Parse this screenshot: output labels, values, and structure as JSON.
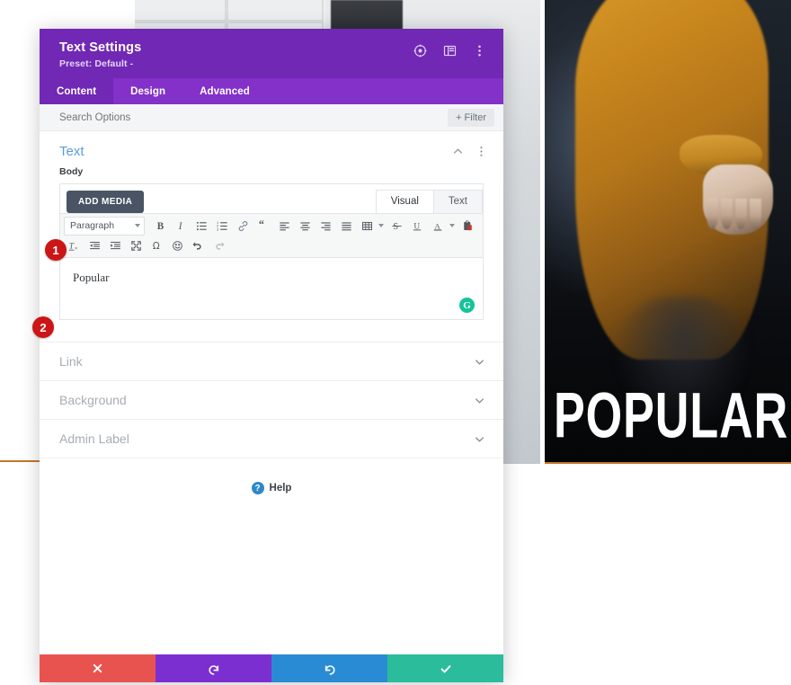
{
  "background": {
    "banner_word": "POPULAR"
  },
  "modal": {
    "title": "Text Settings",
    "preset": "Preset: Default -",
    "header_icons": [
      {
        "name": "target-icon"
      },
      {
        "name": "layout-panel-icon"
      },
      {
        "name": "kebab-menu-icon"
      }
    ],
    "tabs": [
      {
        "label": "Content",
        "active": true
      },
      {
        "label": "Design",
        "active": false
      },
      {
        "label": "Advanced",
        "active": false
      }
    ],
    "search": {
      "value": "",
      "placeholder": "Search Options"
    },
    "filter_button": "+ Filter",
    "section": {
      "title": "Text",
      "field_label": "Body",
      "add_media_button": "ADD MEDIA",
      "editor_tabs": [
        {
          "label": "Visual",
          "active": true
        },
        {
          "label": "Text",
          "active": false
        }
      ],
      "format_select": "Paragraph",
      "toolbar_row_1": [
        "bold-icon",
        "italic-icon",
        "bulleted-list-icon",
        "numbered-list-icon",
        "link-icon",
        "blockquote-icon",
        "align-left-icon",
        "align-center-icon",
        "align-right-icon",
        "align-justify-icon",
        "table-icon",
        "strikethrough-icon",
        "underline-icon",
        "text-color-icon",
        "paste-icon"
      ],
      "toolbar_row_2": [
        "clear-formatting-icon",
        "outdent-icon",
        "indent-icon",
        "fullscreen-icon",
        "special-character-icon",
        "emoji-icon",
        "undo-icon",
        "redo-icon"
      ],
      "editor_content": "Popular",
      "grammarly_badge": "G"
    },
    "accordion": [
      {
        "label": "Link"
      },
      {
        "label": "Background"
      },
      {
        "label": "Admin Label"
      }
    ],
    "help": {
      "icon_glyph": "?",
      "label": "Help"
    },
    "footer": [
      {
        "name": "cancel-button",
        "icon": "close-icon"
      },
      {
        "name": "undo-button",
        "icon": "undo-arrow-icon"
      },
      {
        "name": "redo-button",
        "icon": "redo-arrow-icon"
      },
      {
        "name": "save-button",
        "icon": "checkmark-icon"
      }
    ]
  },
  "callouts": [
    {
      "number": "1"
    },
    {
      "number": "2"
    }
  ],
  "colors": {
    "header_purple": "#7128b5",
    "tabbar_purple": "#8331c9",
    "section_title_blue": "#5b9dd9",
    "cancel_red": "#e9534f",
    "undo_purple": "#7b2fd1",
    "redo_blue": "#2a8bd5",
    "save_teal": "#2bbc9b",
    "badge_red": "#cc1616",
    "grammarly_green": "#15c39a"
  }
}
